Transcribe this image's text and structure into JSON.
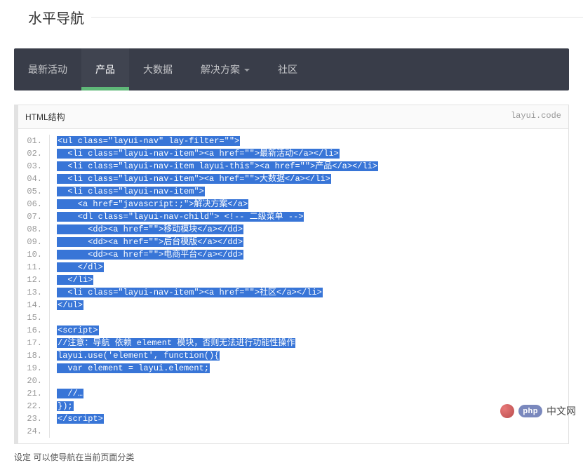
{
  "fieldset_title": "水平导航",
  "nav": {
    "items": [
      {
        "label": "最新活动",
        "active": false,
        "has_dropdown": false
      },
      {
        "label": "产品",
        "active": true,
        "has_dropdown": false
      },
      {
        "label": "大数据",
        "active": false,
        "has_dropdown": false
      },
      {
        "label": "解决方案",
        "active": false,
        "has_dropdown": true
      },
      {
        "label": "社区",
        "active": false,
        "has_dropdown": false
      }
    ]
  },
  "code": {
    "title": "HTML结构",
    "brand": "layui.code",
    "lines": [
      "<ul class=\"layui-nav\" lay-filter=\"\">",
      "  <li class=\"layui-nav-item\"><a href=\"\">最新活动</a></li>",
      "  <li class=\"layui-nav-item layui-this\"><a href=\"\">产品</a></li>",
      "  <li class=\"layui-nav-item\"><a href=\"\">大数据</a></li>",
      "  <li class=\"layui-nav-item\">",
      "    <a href=\"javascript:;\">解决方案</a>",
      "    <dl class=\"layui-nav-child\"> <!-- 二级菜单 -->",
      "      <dd><a href=\"\">移动模块</a></dd>",
      "      <dd><a href=\"\">后台模版</a></dd>",
      "      <dd><a href=\"\">电商平台</a></dd>",
      "    </dl>",
      "  </li>",
      "  <li class=\"layui-nav-item\"><a href=\"\">社区</a></li>",
      "</ul>",
      " ",
      "<script>",
      "//注意：导航 依赖 element 模块，否则无法进行功能性操作",
      "layui.use('element', function(){",
      "  var element = layui.element;",
      "  ",
      "  //…",
      "});",
      "</script>",
      ""
    ]
  },
  "watermark": {
    "php": "php",
    "text": "中文网"
  },
  "footer_truncated": "设定          可以使导航在当前页面分类"
}
